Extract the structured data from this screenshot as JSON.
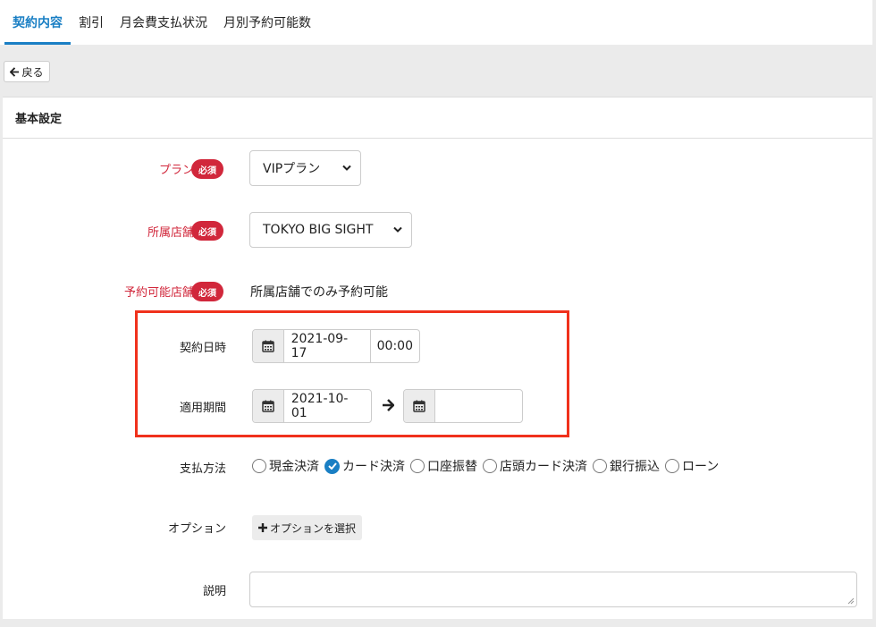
{
  "tabs": [
    {
      "label": "契約内容"
    },
    {
      "label": "割引"
    },
    {
      "label": "月会費支払状況"
    },
    {
      "label": "月別予約可能数"
    }
  ],
  "back_label": "戻る",
  "section_title": "基本設定",
  "required_badge": "必須",
  "plan": {
    "label": "プラン",
    "value": "VIPプラン"
  },
  "store": {
    "label": "所属店舗",
    "value": "TOKYO BIG SIGHT"
  },
  "reservable": {
    "label": "予約可能店舗",
    "value": "所属店舗でのみ予約可能"
  },
  "contract_date": {
    "label": "契約日時",
    "date": "2021-09-17",
    "time": "00:00"
  },
  "apply_period": {
    "label": "適用期間",
    "start": "2021-10-01",
    "end": ""
  },
  "payment": {
    "label": "支払方法",
    "options": [
      "現金決済",
      "カード決済",
      "口座振替",
      "店頭カード決済",
      "銀行振込",
      "ローン"
    ],
    "selected": "カード決済"
  },
  "options": {
    "label": "オプション",
    "button_label": "オプションを選択"
  },
  "description": {
    "label": "説明",
    "value": ""
  },
  "colors": {
    "accent": "#1a7fc4",
    "required": "#d1273b",
    "highlight": "#f0311c"
  }
}
